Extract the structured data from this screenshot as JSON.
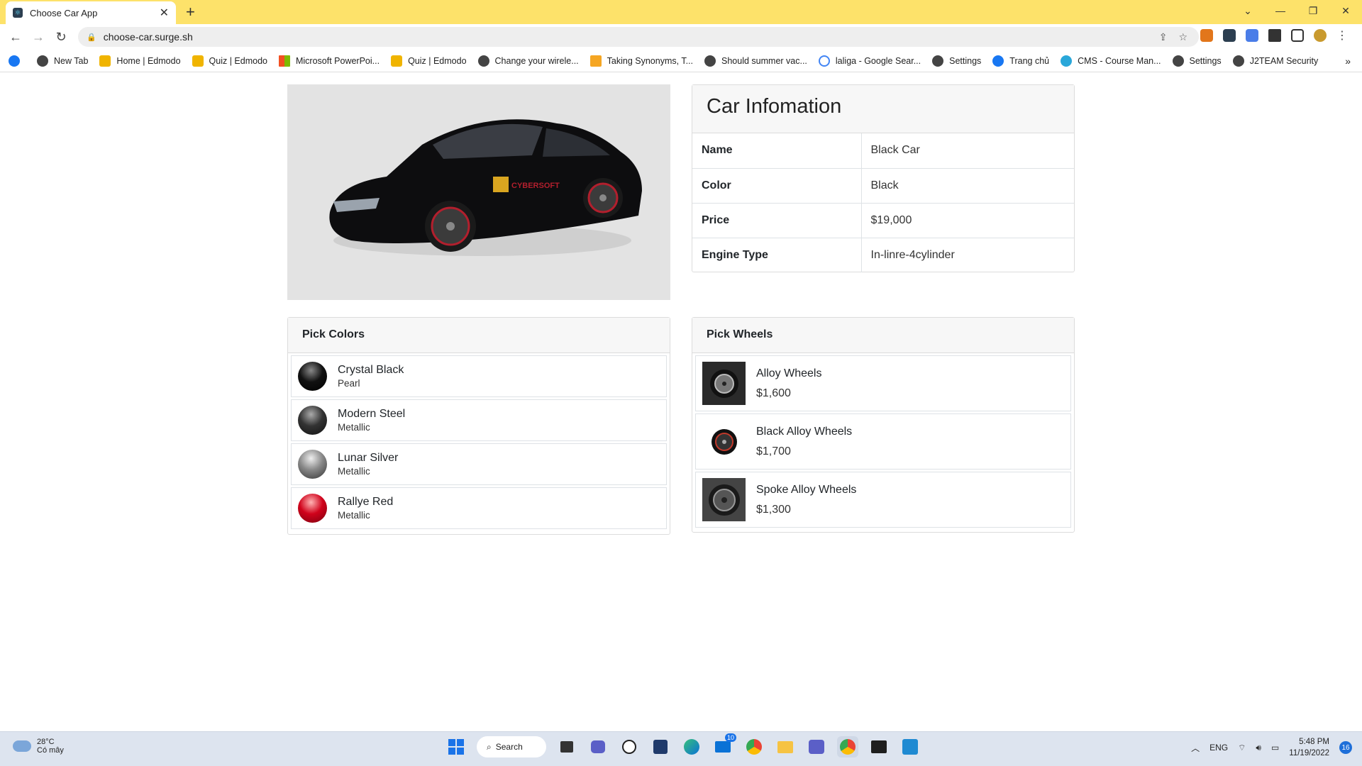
{
  "browser": {
    "tab_title": "Choose Car App",
    "tab_close": "✕",
    "new_tab": "+",
    "url": "choose-car.surge.sh",
    "bookmarks": [
      {
        "label": "New Tab",
        "color": "#444444"
      },
      {
        "label": "Home | Edmodo",
        "color": "#f0b400"
      },
      {
        "label": "Quiz | Edmodo",
        "color": "#f0b400"
      },
      {
        "label": "Microsoft PowerPoi...",
        "color": "#e8512f"
      },
      {
        "label": "Quiz | Edmodo",
        "color": "#f0b400"
      },
      {
        "label": "Change your wirele...",
        "color": "#444444"
      },
      {
        "label": "Taking Synonyms, T...",
        "color": "#f5a623"
      },
      {
        "label": "Should summer vac...",
        "color": "#444444"
      },
      {
        "label": "laliga - Google Sear...",
        "color": "#4285f4"
      },
      {
        "label": "Settings",
        "color": "#444444"
      },
      {
        "label": "Trang chủ",
        "color": "#1877f2"
      },
      {
        "label": "CMS - Course Man...",
        "color": "#2aa7d9"
      },
      {
        "label": "Settings",
        "color": "#444444"
      },
      {
        "label": "J2TEAM Security",
        "color": "#444444"
      }
    ]
  },
  "car": {
    "title": "Car Infomation",
    "image_label": "CYBERSOFT",
    "rows": [
      {
        "key": "Name",
        "value": "Black Car"
      },
      {
        "key": "Color",
        "value": "Black"
      },
      {
        "key": "Price",
        "value": "$19,000"
      },
      {
        "key": "Engine Type",
        "value": "In-linre-4cylinder"
      }
    ]
  },
  "colors": {
    "title": "Pick Colors",
    "items": [
      {
        "name": "Crystal Black",
        "finish": "Pearl",
        "color": "#111111"
      },
      {
        "name": "Modern Steel",
        "finish": "Metallic",
        "color": "#333333"
      },
      {
        "name": "Lunar Silver",
        "finish": "Metallic",
        "color": "#888888"
      },
      {
        "name": "Rallye Red",
        "finish": "Metallic",
        "color": "#d0021b"
      }
    ]
  },
  "wheels": {
    "title": "Pick Wheels",
    "items": [
      {
        "name": "Alloy Wheels",
        "price": "$1,600"
      },
      {
        "name": "Black Alloy Wheels",
        "price": "$1,700"
      },
      {
        "name": "Spoke Alloy Wheels",
        "price": "$1,300"
      }
    ]
  },
  "taskbar": {
    "temperature": "28°C",
    "weather": "Có mây",
    "search_label": "Search",
    "mail_badge": "10",
    "lang": "ENG",
    "time": "5:48 PM",
    "date": "11/19/2022",
    "notifications": "16"
  }
}
